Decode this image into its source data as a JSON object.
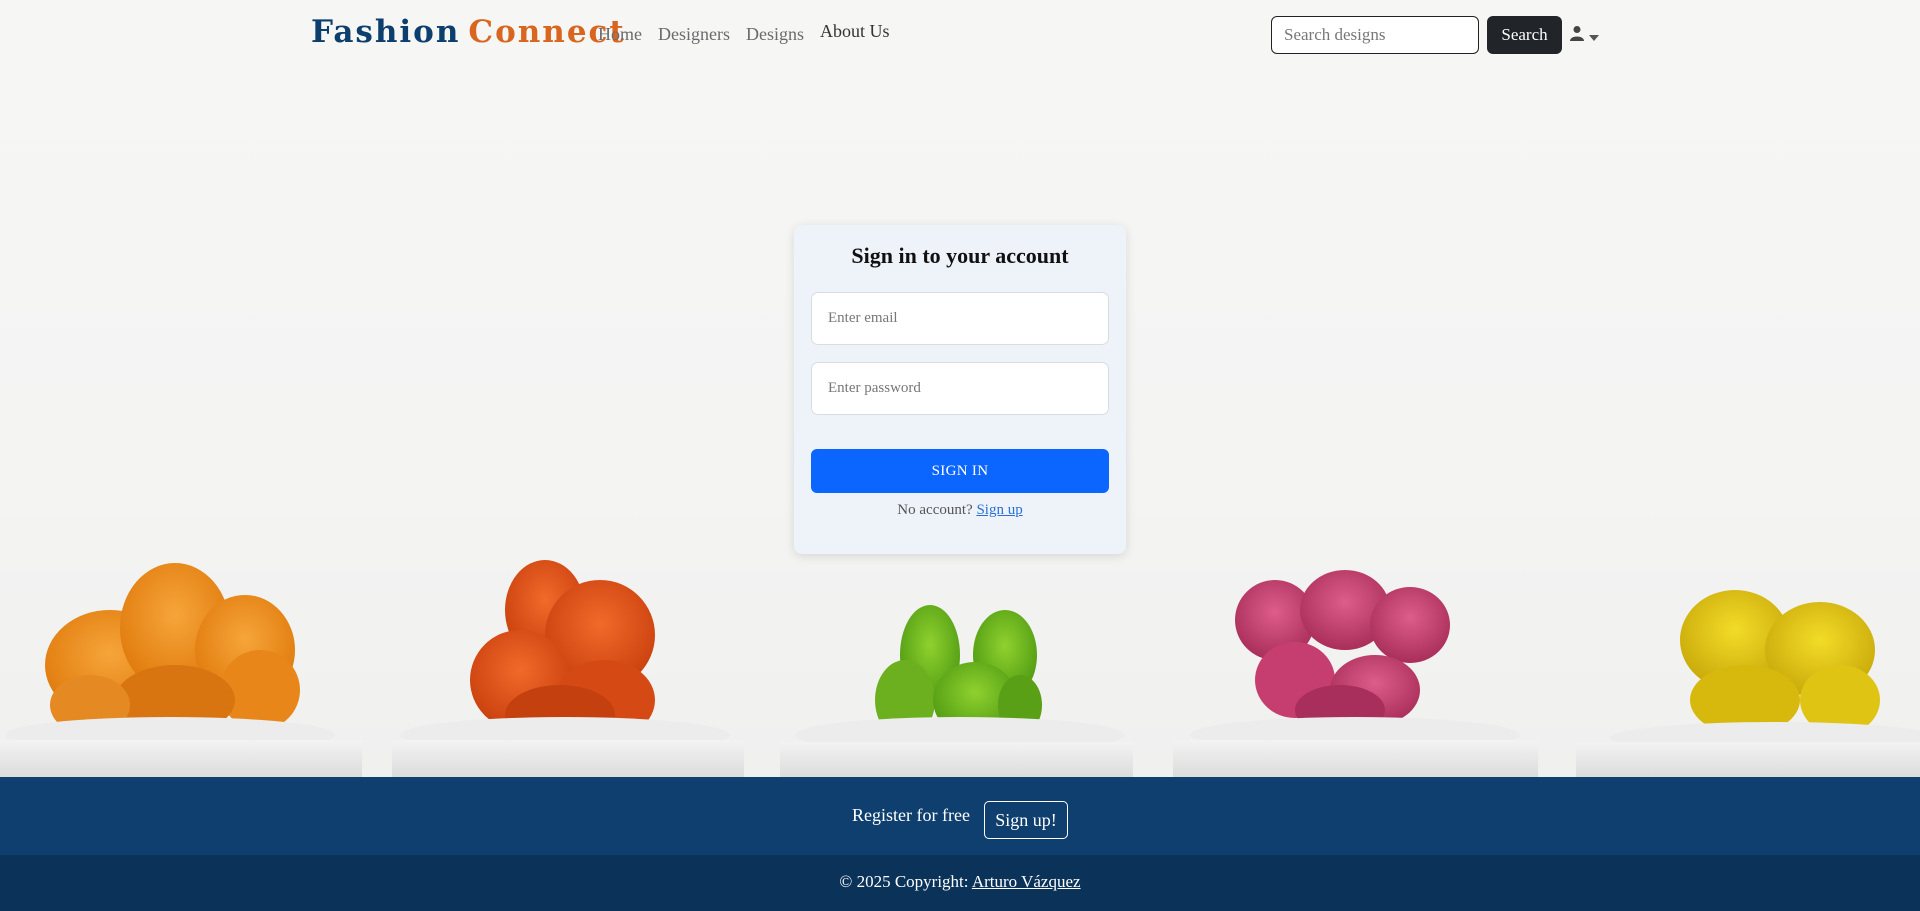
{
  "brand": {
    "part1": "Fashion",
    "part2": "Connect"
  },
  "nav": {
    "links": [
      {
        "label": "Home"
      },
      {
        "label": "Designers"
      },
      {
        "label": "Designs"
      },
      {
        "label": "About Us"
      }
    ]
  },
  "search": {
    "placeholder": "Search designs",
    "button_label": "Search"
  },
  "user_menu": {
    "icon": "user-icon",
    "caret": "caret-down-icon"
  },
  "login": {
    "title": "Sign in to your account",
    "email_placeholder": "Enter email",
    "password_placeholder": "Enter password",
    "submit_label": "SIGN IN",
    "no_account_text": "No account?",
    "signup_link": "Sign up"
  },
  "footer": {
    "register_text": "Register for free",
    "register_button": "Sign up!",
    "copyright_prefix": "© 2025 Copyright:",
    "copyright_author": "Arturo Vázquez"
  },
  "colors": {
    "brand_primary": "#0d3f6e",
    "brand_accent": "#d8661e",
    "primary_button": "#0b66ff",
    "footer_top": "#0e3f6f",
    "footer_bottom": "#0b3259"
  }
}
